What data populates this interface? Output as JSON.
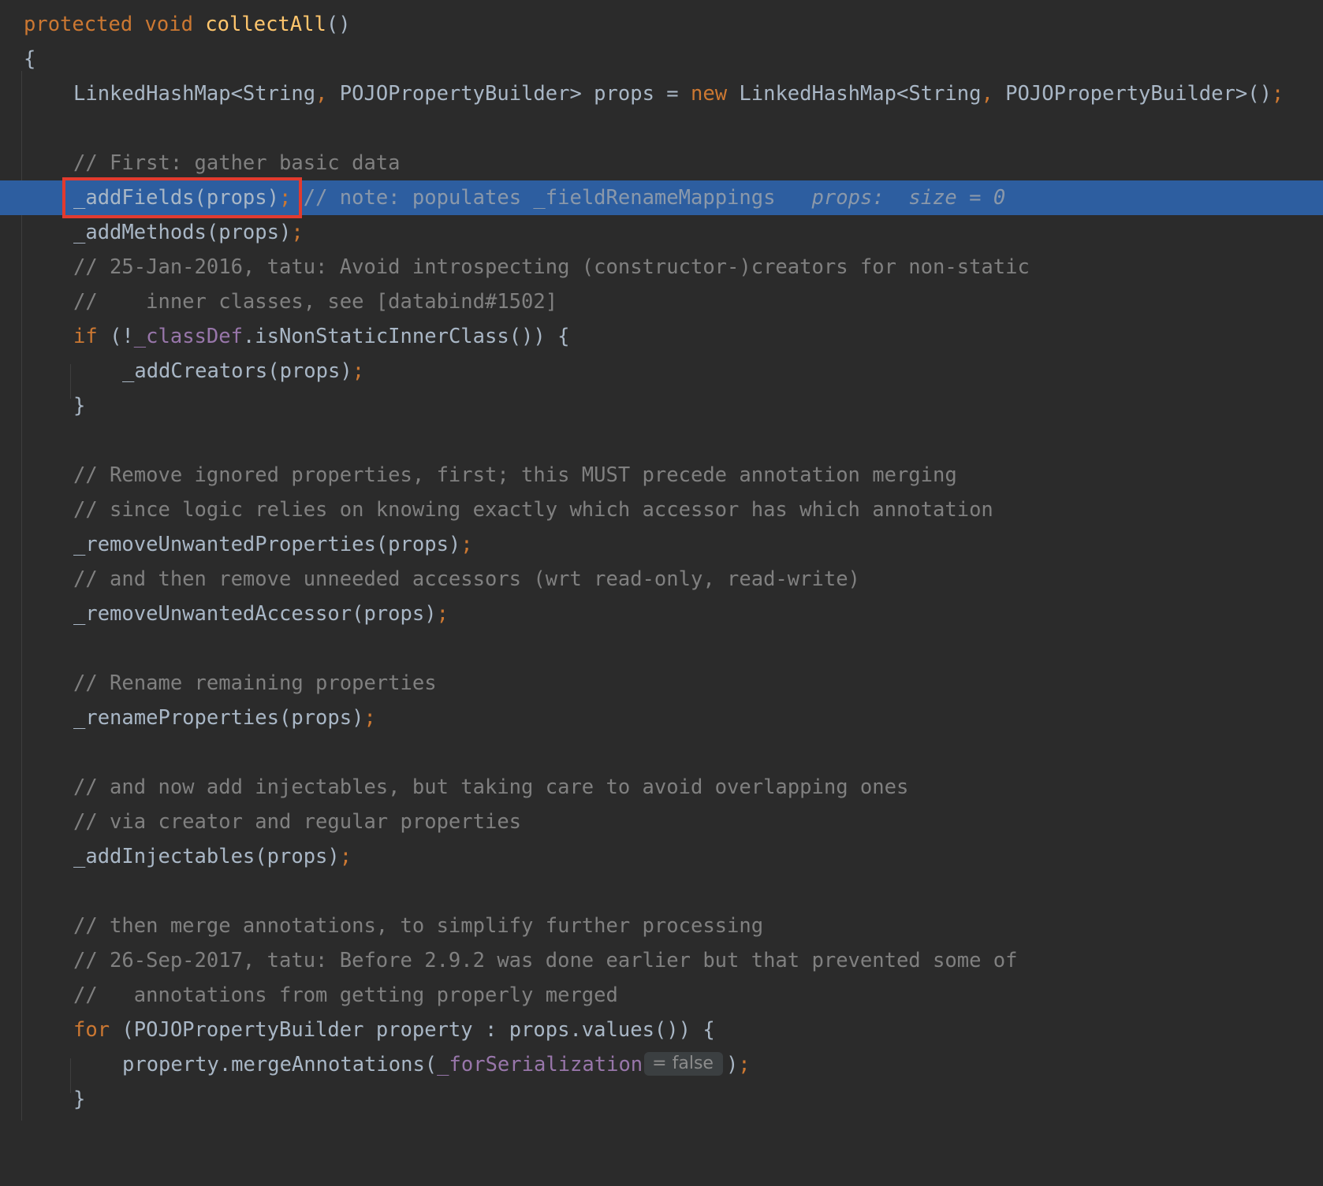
{
  "editor": {
    "lines": {
      "l01": {
        "kw1": "protected",
        "kw2": "void",
        "fn": "collectAll",
        "tail": "()"
      },
      "l02": {
        "brace": "{"
      },
      "l03": {
        "a": "LinkedHashMap<String",
        "c1": ",",
        "b": " POJOPropertyBuilder> props = ",
        "kw": "new",
        "c": " LinkedHashMap<String",
        "c2": ",",
        "d": " POJOPropertyBuilder>()",
        "semi": ";"
      },
      "l05": {
        "comment": "// First: gather basic data"
      },
      "l06": {
        "code": "_addFields(props)",
        "semi": ";",
        "comment": "// note: populates _fieldRenameMappings",
        "debug": "props:  size = 0"
      },
      "l07": {
        "code": "_addMethods(props)",
        "semi": ";"
      },
      "l08": {
        "comment": "// 25-Jan-2016, tatu: Avoid introspecting (constructor-)creators for non-static"
      },
      "l09": {
        "comment": "//    inner classes, see [databind#1502]"
      },
      "l10": {
        "kw": "if",
        "a": " (!",
        "field": "_classDef",
        "b": ".isNonStaticInnerClass()) {"
      },
      "l11": {
        "code": "_addCreators(props)",
        "semi": ";"
      },
      "l12": {
        "brace": "}"
      },
      "l14": {
        "comment": "// Remove ignored properties, first; this MUST precede annotation merging"
      },
      "l15": {
        "comment": "// since logic relies on knowing exactly which accessor has which annotation"
      },
      "l16": {
        "code": "_removeUnwantedProperties(props)",
        "semi": ";"
      },
      "l17": {
        "comment": "// and then remove unneeded accessors (wrt read-only, read-write)"
      },
      "l18": {
        "code": "_removeUnwantedAccessor(props)",
        "semi": ";"
      },
      "l20": {
        "comment": "// Rename remaining properties"
      },
      "l21": {
        "code": "_renameProperties(props)",
        "semi": ";"
      },
      "l23": {
        "comment": "// and now add injectables, but taking care to avoid overlapping ones"
      },
      "l24": {
        "comment": "// via creator and regular properties"
      },
      "l25": {
        "code": "_addInjectables(props)",
        "semi": ";"
      },
      "l27": {
        "comment": "// then merge annotations, to simplify further processing"
      },
      "l28": {
        "comment": "// 26-Sep-2017, tatu: Before 2.9.2 was done earlier but that prevented some of"
      },
      "l29": {
        "comment": "//   annotations from getting properly merged"
      },
      "l30": {
        "kw": "for",
        "a": " (POJOPropertyBuilder property : props.values()) {"
      },
      "l31": {
        "a": "property.mergeAnnotations(",
        "field": "_forSerialization",
        "hint": "= false",
        "b": ")",
        "semi": ";"
      },
      "l32": {
        "brace": "}"
      }
    }
  },
  "colors": {
    "background": "#2b2b2b",
    "current_line": "#2d5ea0",
    "keyword": "#cc7832",
    "method_decl": "#ffc66d",
    "field": "#9876aa",
    "comment": "#808080",
    "highlight_box": "#e23a2e"
  }
}
